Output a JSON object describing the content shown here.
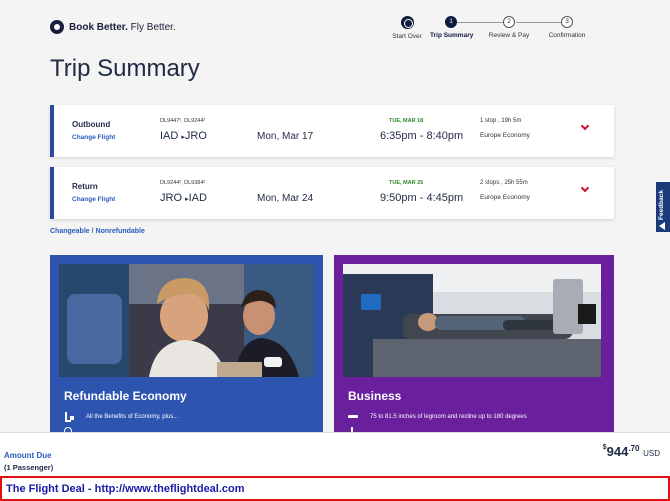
{
  "brand": {
    "bold": "Book Better.",
    "light": " Fly Better."
  },
  "nav": {
    "start_over": "Start Over",
    "steps": [
      {
        "num": "1",
        "label": "Trip Summary",
        "active": true
      },
      {
        "num": "2",
        "label": "Review & Pay",
        "active": false
      },
      {
        "num": "3",
        "label": "Confirmation",
        "active": false
      }
    ]
  },
  "page_title": "Trip Summary",
  "flights": [
    {
      "direction": "Outbound",
      "change_label": "Change Flight",
      "flight_numbers": "DL9447², DL9244²",
      "route_from": "IAD",
      "route_to": "JRO",
      "date": "Mon, Mar 17",
      "arrival_date": "TUE, MAR 18",
      "times": "6:35pm - 8:40pm",
      "stops": "1 stop , 19h 5m",
      "cabin": "Europe Economy"
    },
    {
      "direction": "Return",
      "change_label": "Change Flight",
      "flight_numbers": "DL9244², DL9384²",
      "route_from": "JRO",
      "route_to": "IAD",
      "date": "Mon, Mar 24",
      "arrival_date": "TUE, MAR 25",
      "times": "9:50pm - 4:45pm",
      "stops": "2 stops , 25h 55m",
      "cabin": "Europe Economy"
    }
  ],
  "fare_note": "Changeable / Nonrefundable",
  "fares": [
    {
      "title": "Refundable Economy",
      "feature": "All the Benefits of Economy, plus...",
      "icon": "seat-icon"
    },
    {
      "title": "Business",
      "feature": "75 to 81.5 inches of legroom and recline up to 180 degrees",
      "icon": "legroom-icon"
    }
  ],
  "feedback": "Feedback",
  "amount": {
    "label": "Amount Due",
    "passengers": "(1 Passenger)",
    "currency_symbol": "$",
    "whole": "944",
    "cents": ".70",
    "currency": "USD"
  },
  "watermark": "The Flight Deal - http://www.theflightdeal.com",
  "colors": {
    "accent": "#2a5dbd",
    "navy": "#0f1a3d",
    "red": "#c8102e",
    "green": "#2b8a2b",
    "economy": "#2d55b0",
    "business": "#6a1f9c"
  }
}
